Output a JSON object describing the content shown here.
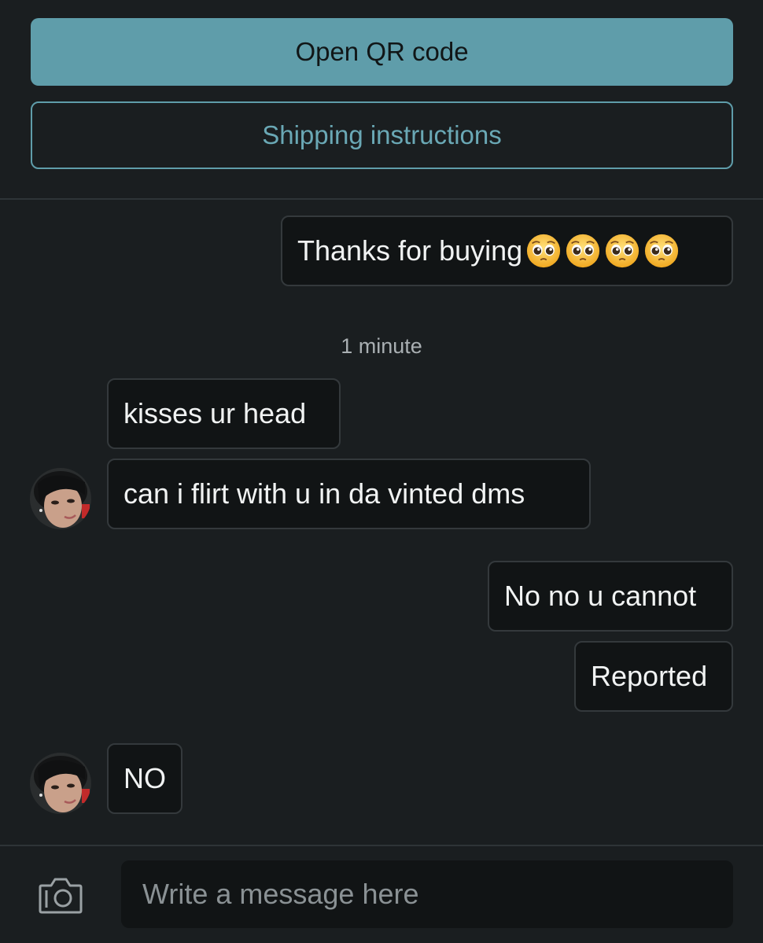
{
  "actions": {
    "qr_label": "Open QR code",
    "shipping_label": "Shipping instructions"
  },
  "messages": [
    {
      "sender": "me",
      "text": "Thanks for buying",
      "emojis": [
        "pleading-face",
        "pleading-face",
        "pleading-face",
        "pleading-face"
      ]
    },
    {
      "sender": "other",
      "text": "kisses ur head"
    },
    {
      "sender": "other",
      "text": "can i flirt with u in da vinted dms"
    },
    {
      "sender": "me",
      "text": "No no u cannot"
    },
    {
      "sender": "me",
      "text": "Reported"
    },
    {
      "sender": "other",
      "text": "NO"
    }
  ],
  "timestamp": "1 minute",
  "composer": {
    "placeholder": "Write a message here",
    "camera_icon": "camera-icon"
  },
  "colors": {
    "accent": "#5f9daa",
    "background": "#1a1e20",
    "bubble": "#111415"
  }
}
